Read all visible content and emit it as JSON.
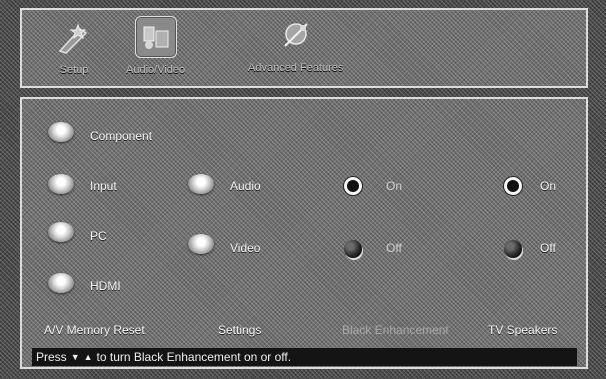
{
  "tabs": [
    {
      "label": "Setup",
      "icon": "wand-icon"
    },
    {
      "label": "Audio/Video",
      "icon": "audio-video-icon"
    },
    {
      "label": "Advanced Features",
      "icon": "advanced-features-icon"
    }
  ],
  "sources": {
    "component": "Component",
    "input": "Input",
    "pc": "PC",
    "hdmi": "HDMI"
  },
  "settings": {
    "audio": "Audio",
    "video": "Video"
  },
  "black_enhancement": {
    "on": "On",
    "off": "Off",
    "selected": "On"
  },
  "tv_speakers": {
    "on": "On",
    "off": "Off",
    "selected": "On"
  },
  "bottom_labels": {
    "av_memory_reset": "A/V Memory Reset",
    "settings": "Settings",
    "black_enhancement": "Black Enhancement",
    "tv_speakers": "TV Speakers"
  },
  "footer": {
    "prefix": "Press",
    "suffix": "to turn Black Enhancement on or off."
  }
}
